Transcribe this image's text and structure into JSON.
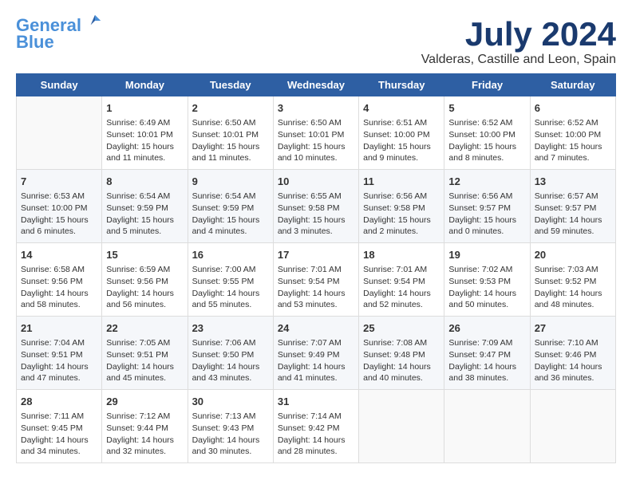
{
  "header": {
    "logo_line1": "General",
    "logo_line2": "Blue",
    "month_year": "July 2024",
    "location": "Valderas, Castille and Leon, Spain"
  },
  "days_of_week": [
    "Sunday",
    "Monday",
    "Tuesday",
    "Wednesday",
    "Thursday",
    "Friday",
    "Saturday"
  ],
  "weeks": [
    [
      {
        "day": "",
        "empty": true
      },
      {
        "day": "1",
        "sunrise": "Sunrise: 6:49 AM",
        "sunset": "Sunset: 10:01 PM",
        "daylight": "Daylight: 15 hours and 11 minutes."
      },
      {
        "day": "2",
        "sunrise": "Sunrise: 6:50 AM",
        "sunset": "Sunset: 10:01 PM",
        "daylight": "Daylight: 15 hours and 11 minutes."
      },
      {
        "day": "3",
        "sunrise": "Sunrise: 6:50 AM",
        "sunset": "Sunset: 10:01 PM",
        "daylight": "Daylight: 15 hours and 10 minutes."
      },
      {
        "day": "4",
        "sunrise": "Sunrise: 6:51 AM",
        "sunset": "Sunset: 10:00 PM",
        "daylight": "Daylight: 15 hours and 9 minutes."
      },
      {
        "day": "5",
        "sunrise": "Sunrise: 6:52 AM",
        "sunset": "Sunset: 10:00 PM",
        "daylight": "Daylight: 15 hours and 8 minutes."
      },
      {
        "day": "6",
        "sunrise": "Sunrise: 6:52 AM",
        "sunset": "Sunset: 10:00 PM",
        "daylight": "Daylight: 15 hours and 7 minutes."
      }
    ],
    [
      {
        "day": "7",
        "sunrise": "Sunrise: 6:53 AM",
        "sunset": "Sunset: 10:00 PM",
        "daylight": "Daylight: 15 hours and 6 minutes."
      },
      {
        "day": "8",
        "sunrise": "Sunrise: 6:54 AM",
        "sunset": "Sunset: 9:59 PM",
        "daylight": "Daylight: 15 hours and 5 minutes."
      },
      {
        "day": "9",
        "sunrise": "Sunrise: 6:54 AM",
        "sunset": "Sunset: 9:59 PM",
        "daylight": "Daylight: 15 hours and 4 minutes."
      },
      {
        "day": "10",
        "sunrise": "Sunrise: 6:55 AM",
        "sunset": "Sunset: 9:58 PM",
        "daylight": "Daylight: 15 hours and 3 minutes."
      },
      {
        "day": "11",
        "sunrise": "Sunrise: 6:56 AM",
        "sunset": "Sunset: 9:58 PM",
        "daylight": "Daylight: 15 hours and 2 minutes."
      },
      {
        "day": "12",
        "sunrise": "Sunrise: 6:56 AM",
        "sunset": "Sunset: 9:57 PM",
        "daylight": "Daylight: 15 hours and 0 minutes."
      },
      {
        "day": "13",
        "sunrise": "Sunrise: 6:57 AM",
        "sunset": "Sunset: 9:57 PM",
        "daylight": "Daylight: 14 hours and 59 minutes."
      }
    ],
    [
      {
        "day": "14",
        "sunrise": "Sunrise: 6:58 AM",
        "sunset": "Sunset: 9:56 PM",
        "daylight": "Daylight: 14 hours and 58 minutes."
      },
      {
        "day": "15",
        "sunrise": "Sunrise: 6:59 AM",
        "sunset": "Sunset: 9:56 PM",
        "daylight": "Daylight: 14 hours and 56 minutes."
      },
      {
        "day": "16",
        "sunrise": "Sunrise: 7:00 AM",
        "sunset": "Sunset: 9:55 PM",
        "daylight": "Daylight: 14 hours and 55 minutes."
      },
      {
        "day": "17",
        "sunrise": "Sunrise: 7:01 AM",
        "sunset": "Sunset: 9:54 PM",
        "daylight": "Daylight: 14 hours and 53 minutes."
      },
      {
        "day": "18",
        "sunrise": "Sunrise: 7:01 AM",
        "sunset": "Sunset: 9:54 PM",
        "daylight": "Daylight: 14 hours and 52 minutes."
      },
      {
        "day": "19",
        "sunrise": "Sunrise: 7:02 AM",
        "sunset": "Sunset: 9:53 PM",
        "daylight": "Daylight: 14 hours and 50 minutes."
      },
      {
        "day": "20",
        "sunrise": "Sunrise: 7:03 AM",
        "sunset": "Sunset: 9:52 PM",
        "daylight": "Daylight: 14 hours and 48 minutes."
      }
    ],
    [
      {
        "day": "21",
        "sunrise": "Sunrise: 7:04 AM",
        "sunset": "Sunset: 9:51 PM",
        "daylight": "Daylight: 14 hours and 47 minutes."
      },
      {
        "day": "22",
        "sunrise": "Sunrise: 7:05 AM",
        "sunset": "Sunset: 9:51 PM",
        "daylight": "Daylight: 14 hours and 45 minutes."
      },
      {
        "day": "23",
        "sunrise": "Sunrise: 7:06 AM",
        "sunset": "Sunset: 9:50 PM",
        "daylight": "Daylight: 14 hours and 43 minutes."
      },
      {
        "day": "24",
        "sunrise": "Sunrise: 7:07 AM",
        "sunset": "Sunset: 9:49 PM",
        "daylight": "Daylight: 14 hours and 41 minutes."
      },
      {
        "day": "25",
        "sunrise": "Sunrise: 7:08 AM",
        "sunset": "Sunset: 9:48 PM",
        "daylight": "Daylight: 14 hours and 40 minutes."
      },
      {
        "day": "26",
        "sunrise": "Sunrise: 7:09 AM",
        "sunset": "Sunset: 9:47 PM",
        "daylight": "Daylight: 14 hours and 38 minutes."
      },
      {
        "day": "27",
        "sunrise": "Sunrise: 7:10 AM",
        "sunset": "Sunset: 9:46 PM",
        "daylight": "Daylight: 14 hours and 36 minutes."
      }
    ],
    [
      {
        "day": "28",
        "sunrise": "Sunrise: 7:11 AM",
        "sunset": "Sunset: 9:45 PM",
        "daylight": "Daylight: 14 hours and 34 minutes."
      },
      {
        "day": "29",
        "sunrise": "Sunrise: 7:12 AM",
        "sunset": "Sunset: 9:44 PM",
        "daylight": "Daylight: 14 hours and 32 minutes."
      },
      {
        "day": "30",
        "sunrise": "Sunrise: 7:13 AM",
        "sunset": "Sunset: 9:43 PM",
        "daylight": "Daylight: 14 hours and 30 minutes."
      },
      {
        "day": "31",
        "sunrise": "Sunrise: 7:14 AM",
        "sunset": "Sunset: 9:42 PM",
        "daylight": "Daylight: 14 hours and 28 minutes."
      },
      {
        "day": "",
        "empty": true
      },
      {
        "day": "",
        "empty": true
      },
      {
        "day": "",
        "empty": true
      }
    ]
  ]
}
